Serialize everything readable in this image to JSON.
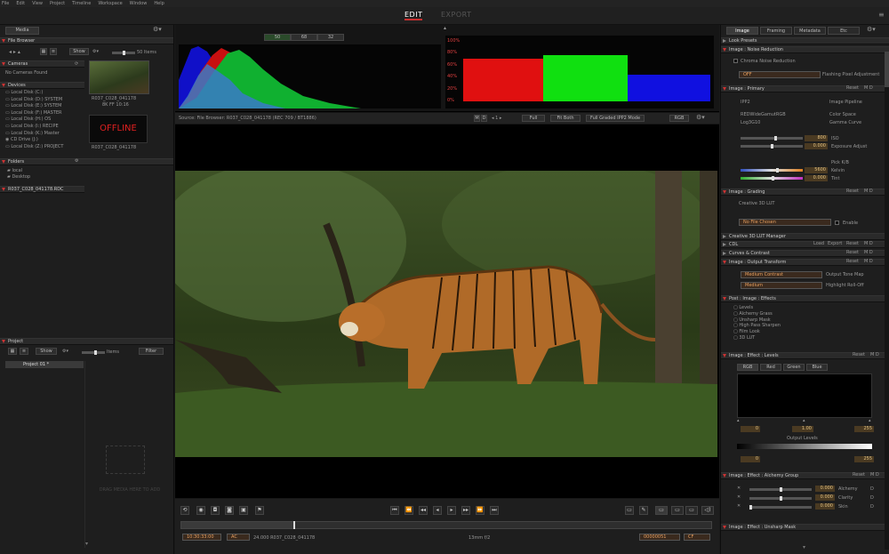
{
  "menu": [
    "File",
    "Edit",
    "View",
    "Project",
    "Timeline",
    "Workspace",
    "Window",
    "Help"
  ],
  "modes": {
    "edit": "EDIT",
    "export": "EXPORT"
  },
  "left": {
    "media_tab": "Media",
    "file_browser": "File Browser",
    "show": "Show",
    "items_label": "50 Items",
    "cameras": "Cameras",
    "no_cameras": "No Cameras Found",
    "devices": "Devices",
    "device_list": [
      "Local Disk (C:)",
      "Local Disk (D:) SYSTEM",
      "Local Disk (E:) SYSTEM",
      "Local Disk (F:) MASTER",
      "Local Disk (H:) OS",
      "Local Disk (I:) RECIPE",
      "Local Disk (K:) Master",
      "CD Drive (J:)",
      "Local Disk (Z:) PROJECT"
    ],
    "thumb1_name": "R037_C028_041178",
    "thumb1_meta": "8K FF   10:16",
    "offline": "OFFLINE",
    "thumb2_name": "R037_C028_041178",
    "folders": "Folders",
    "folder_list": [
      "local",
      "Desktop"
    ],
    "clip_path": "R037_C028_041178.RDC",
    "project": "Project",
    "project_show": "Show",
    "project_items": "Items",
    "filter": "Filter",
    "project_item": "Project 01 *",
    "drag_media": "DRAG MEDIA HERE TO ADD"
  },
  "scope": {
    "tabs": [
      "50",
      "68",
      "32"
    ],
    "y_labels": [
      "100%",
      "80%",
      "60%",
      "40%",
      "20%",
      "0%"
    ]
  },
  "viewer": {
    "source": "Source: File Browser: R037_C028_041178    (REC 709 / BT1886)",
    "md": [
      "M",
      "D"
    ],
    "fit": "Full",
    "fit_both": "Fit Both",
    "graded": "Full Graded IPP2 Mode",
    "rgb": "RGB"
  },
  "transport": {
    "timecode": "10:30:33:00",
    "ac": "AC",
    "clip_info": "24.000   R037_C028_041178",
    "center_info": "13mm   f/2",
    "frame": "00000051",
    "cf": "CF"
  },
  "right": {
    "tabs": [
      "Image",
      "Framing",
      "Metadata",
      "Etc"
    ],
    "look_presets": "Look Presets",
    "noise": "Image : Noise Reduction",
    "chroma_noise": "Chroma Noise Reduction",
    "off": "OFF",
    "flashing": "Flashing Pixel Adjustment",
    "primary": "Image : Primary",
    "reset": "Reset",
    "ipp2": "IPP2",
    "image_pipeline": "Image Pipeline",
    "redwide": "REDWideGamutRGB",
    "color_space": "Color Space",
    "log3g10": "Log3G10",
    "gamma_curve": "Gamma Curve",
    "iso_val": "800",
    "iso": "ISO",
    "exposure_val": "0.000",
    "exposure": "Exposure Adjust",
    "pick_kelvin": "Pick K/B",
    "kelvin_val": "5600",
    "kelvin": "Kelvin",
    "tint_val": "0.000",
    "tint": "Tint",
    "grading": "Image : Grading",
    "creative_lut": "Creative 3D LUT",
    "no_file": "No File Chosen",
    "enable": "Enable",
    "lut_manager": "Creative 3D LUT Manager",
    "cdl": "CDL",
    "load": "Load",
    "export": "Export",
    "curves": "Curves & Contrast",
    "output": "Image : Output Transform",
    "medium_contrast": "Medium Contrast",
    "output_tonemap": "Output Tone Map",
    "medium": "Medium",
    "highlight": "Highlight Roll-Off",
    "post_effects": "Post : Image : Effects",
    "effects": [
      "Levels",
      "Alchemy Grass",
      "Unsharp Mask",
      "High Pass Sharpen",
      "Film Look",
      "3D LUT"
    ],
    "levels": "Image : Effect : Levels",
    "level_tabs": [
      "RGB",
      "Red",
      "Green",
      "Blue"
    ],
    "lv1": "0",
    "lv2": "1.00",
    "lv3": "255",
    "output_levels": "Output Levels",
    "ol1": "0",
    "ol2": "255",
    "alchemy": "Image : Effect : Alchemy Group",
    "alchemy_rows": [
      {
        "v": "0.000",
        "l": "Alchemy"
      },
      {
        "v": "0.000",
        "l": "Clarity"
      },
      {
        "v": "0.000",
        "l": "Skin"
      }
    ],
    "unsharp": "Image : Effect : Unsharp Mask"
  },
  "colors": {
    "accent": "#c83030",
    "highlight": "#e8a060"
  }
}
